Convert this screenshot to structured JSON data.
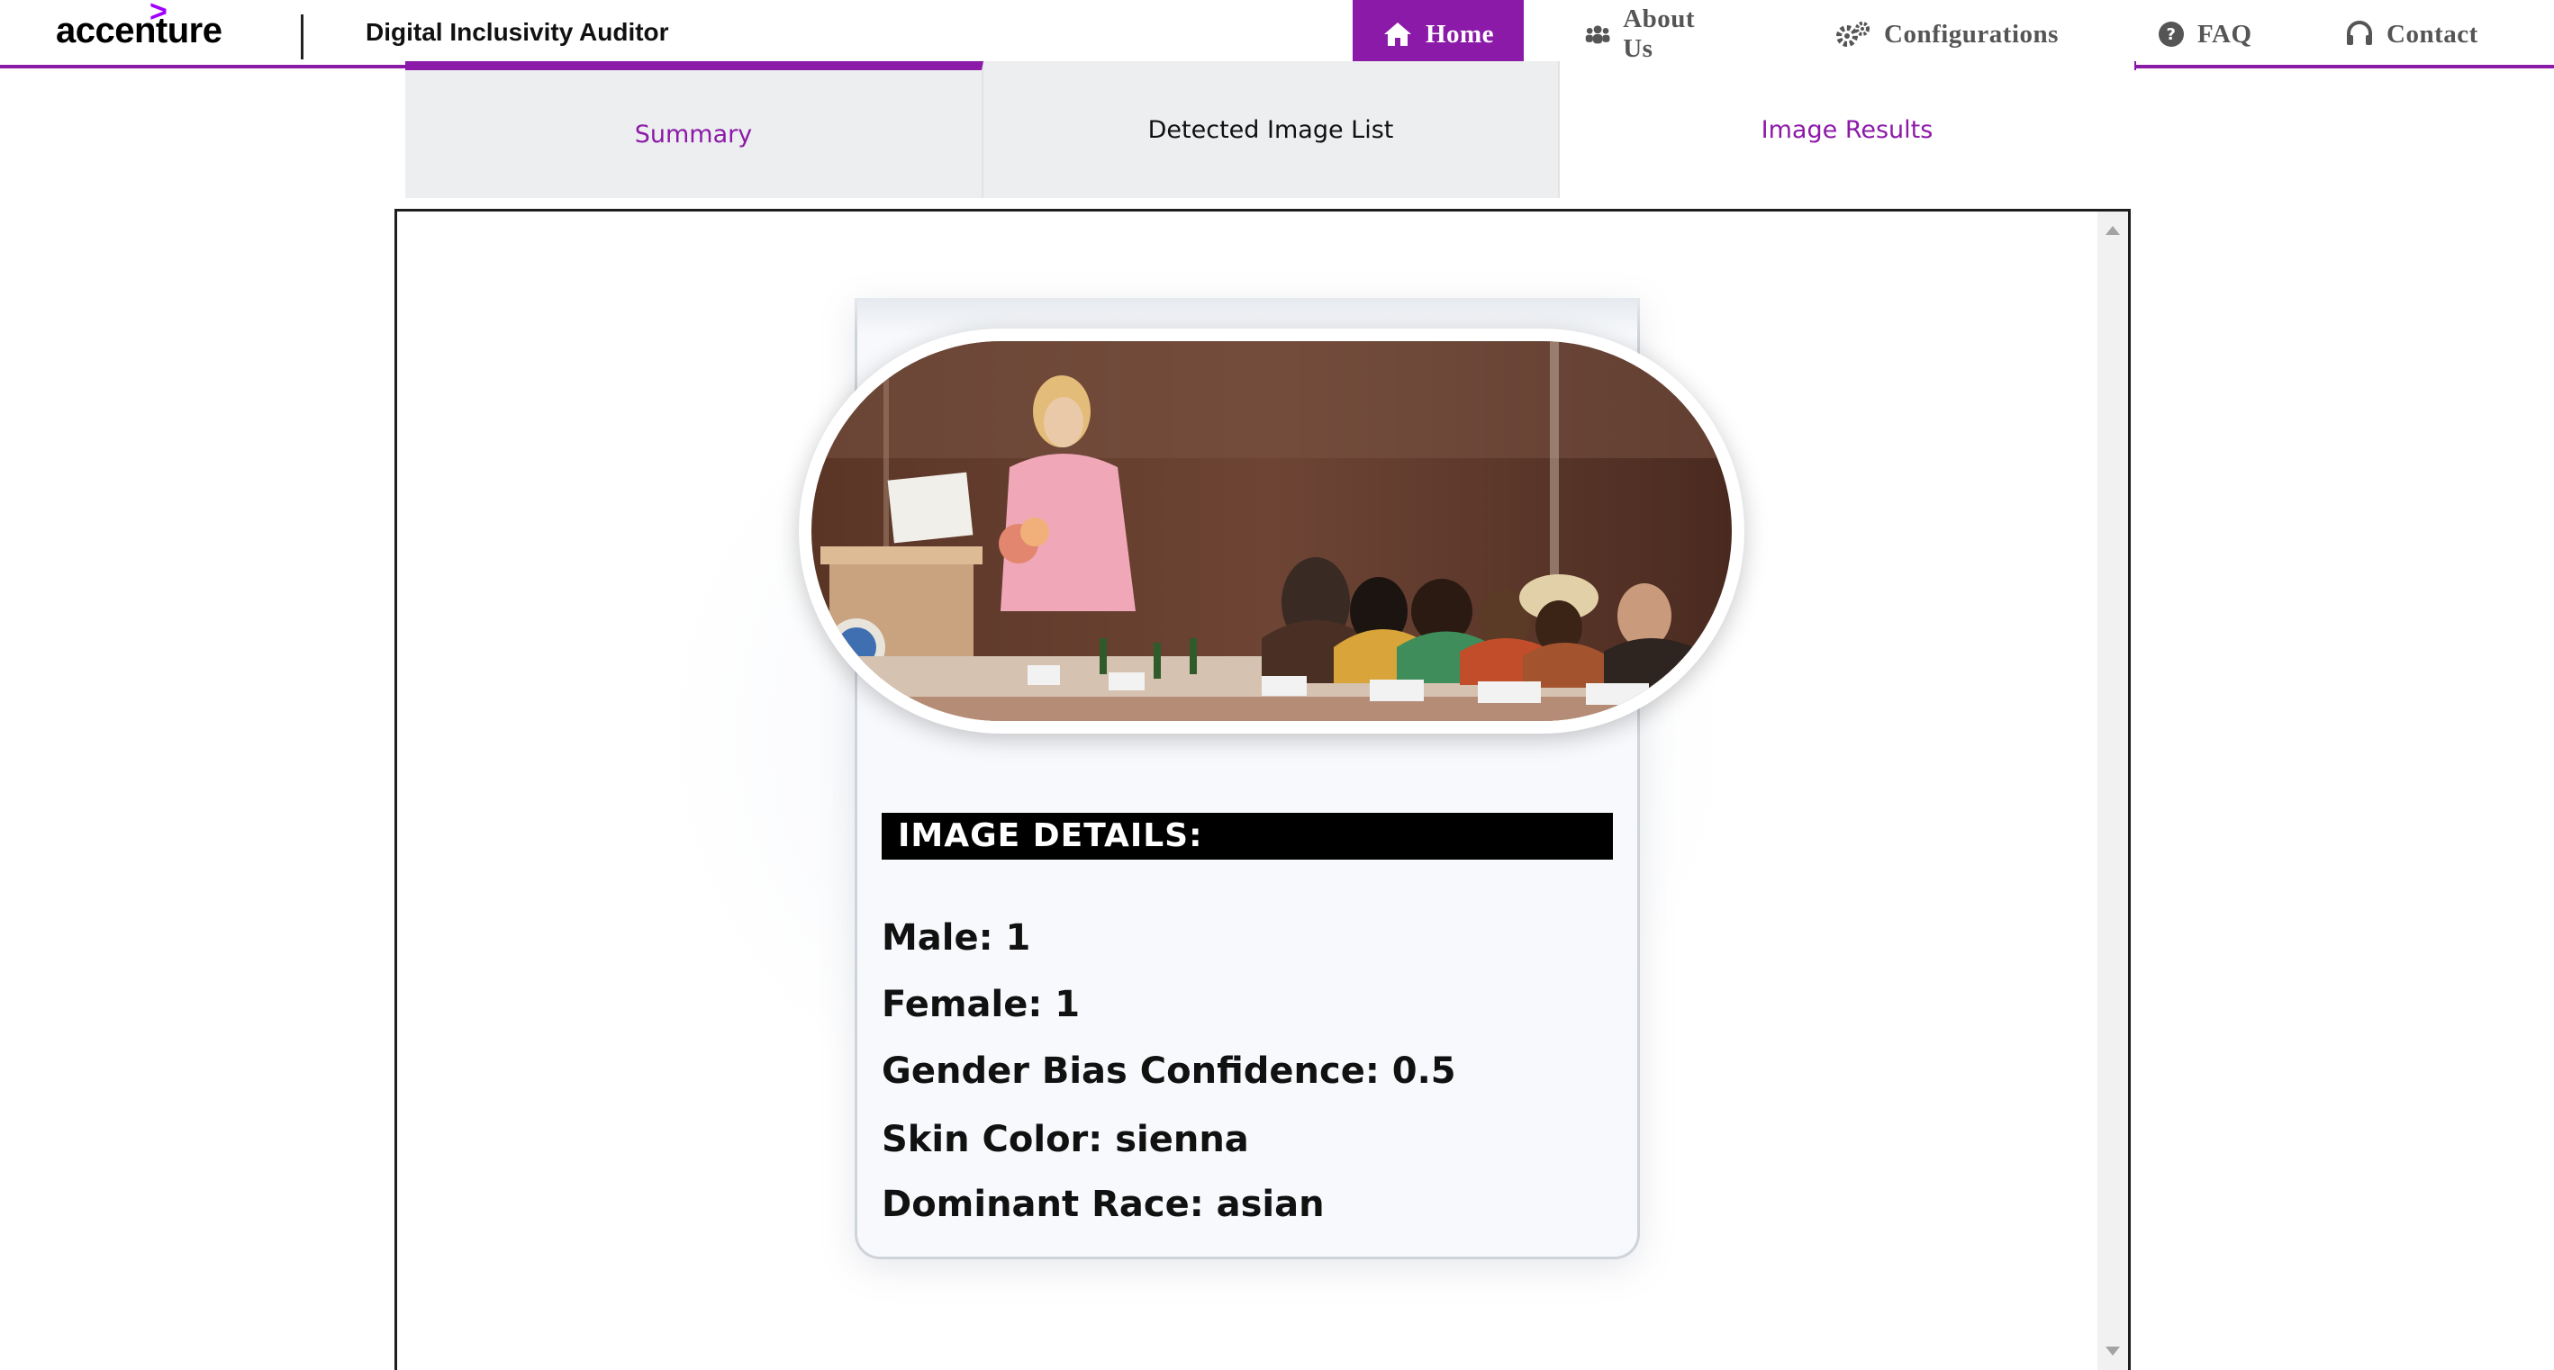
{
  "brand": {
    "logo_text": "accenture",
    "chevron": ">",
    "app_title": "Digital Inclusivity Auditor",
    "accent_color": "#8c1aa8"
  },
  "nav": {
    "items": [
      {
        "label": "Home",
        "icon": "home-icon",
        "active": true
      },
      {
        "label": "About Us",
        "icon": "users-icon",
        "active": false
      },
      {
        "label": "Configurations",
        "icon": "gears-icon",
        "active": false
      },
      {
        "label": "FAQ",
        "icon": "question-circle-icon",
        "active": false
      },
      {
        "label": "Contact",
        "icon": "headset-icon",
        "active": false
      }
    ]
  },
  "tabs": [
    {
      "label": "Summary",
      "selected": false
    },
    {
      "label": "Detected Image List",
      "selected": false
    },
    {
      "label": "Image Results",
      "selected": true
    }
  ],
  "result": {
    "image_description": "conference photo",
    "details_header": "IMAGE DETAILS:",
    "details": [
      {
        "text": "Male: 1"
      },
      {
        "text": "Female: 1"
      },
      {
        "text": "Gender Bias Confidence: 0.5"
      },
      {
        "text": "Skin Color: sienna"
      },
      {
        "text": "Dominant Race: asian"
      }
    ]
  }
}
